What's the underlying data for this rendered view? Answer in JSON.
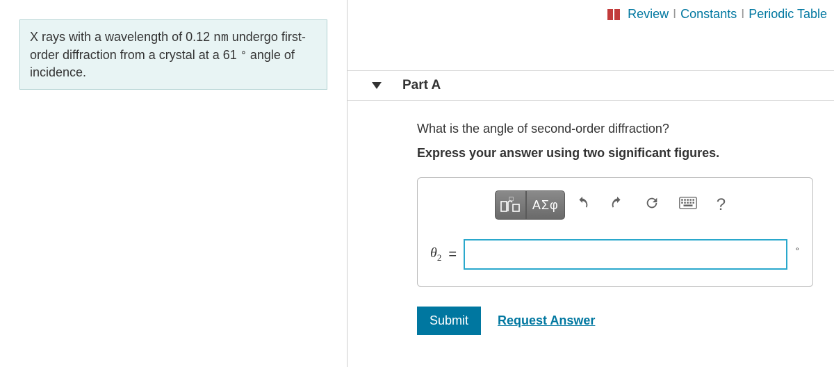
{
  "problem": {
    "prefix": "X rays with a wavelength of 0.12 ",
    "unit": "nm",
    "mid": " undergo first-order diffraction from a crystal at a 61 ",
    "deg_symbol": "∘",
    "suffix": " angle of incidence."
  },
  "top_links": {
    "review": "Review",
    "constants": "Constants",
    "periodic": "Periodic Table"
  },
  "part": {
    "title": "Part A",
    "question": "What is the angle of second-order diffraction?",
    "instruction": "Express your answer using two significant figures.",
    "toolbar": {
      "greek_btn": "ΑΣφ",
      "help_btn": "?"
    },
    "answer": {
      "var": "θ",
      "sub": "2",
      "equals": "=",
      "unit": "∘",
      "value": ""
    },
    "submit": "Submit",
    "request": "Request Answer"
  }
}
